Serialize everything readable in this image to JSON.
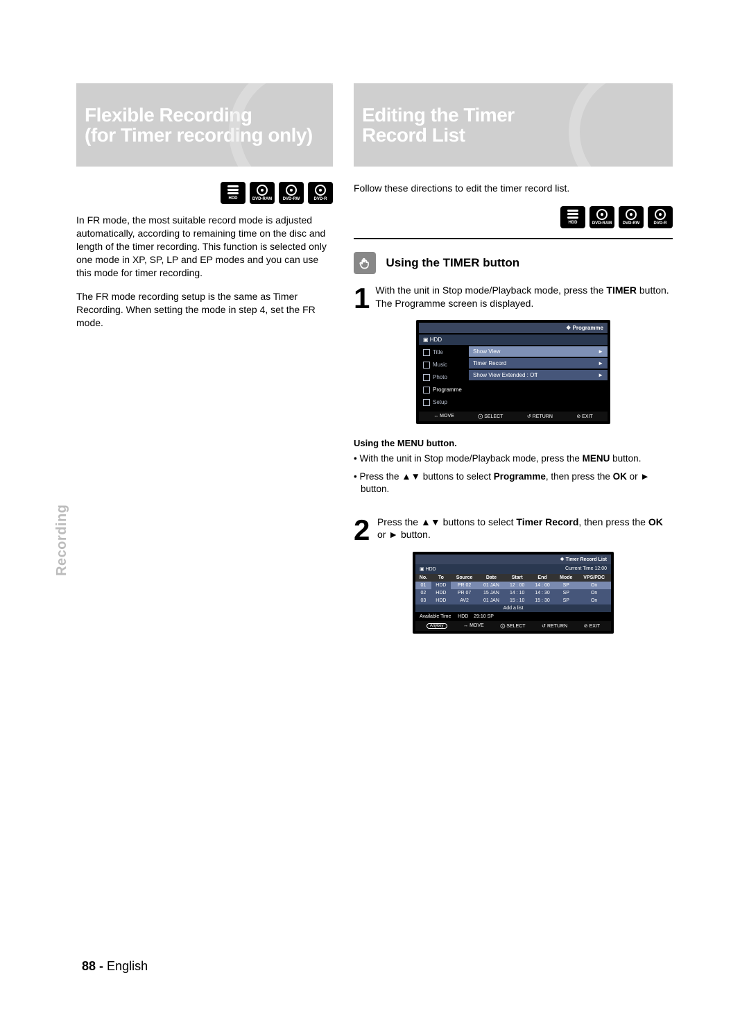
{
  "side_tab": "Recording",
  "page_number": "88 -",
  "page_lang": "English",
  "left": {
    "hero_line1": "Flexible Recording",
    "hero_line2": "(for Timer recording only)",
    "icons": [
      "HDD",
      "DVD-RAM",
      "DVD-RW",
      "DVD-R"
    ],
    "para1": "In FR mode, the most suitable record mode is adjusted automatically, according to remaining time on the disc and length of the timer recording. This function is selected only one mode in XP, SP, LP and EP modes and you can use this mode for timer recording.",
    "para2": "The FR mode recording setup is the same as Timer Recording. When setting the mode in step 4, set the FR mode."
  },
  "right": {
    "hero_line1": "Editing the Timer",
    "hero_line2": "Record List",
    "intro": "Follow these directions to edit the timer record list.",
    "icons": [
      "HDD",
      "DVD-RAM",
      "DVD-RW",
      "DVD-R"
    ],
    "sub_heading": "Using the TIMER button",
    "step1": {
      "num": "1",
      "pre": "With the unit in Stop mode/Playback mode, press the ",
      "bold1": "TIMER",
      "post": " button. The Programme screen is displayed."
    },
    "screen1": {
      "title_prefix": "❖ ",
      "title": "Programme",
      "hdd_label": "HDD",
      "menu_items": [
        "Title",
        "Music",
        "Photo",
        "Programme",
        "Setup"
      ],
      "panel_rows": [
        {
          "label": "Show View",
          "arrow": "►"
        },
        {
          "label": "Timer Record",
          "arrow": "►"
        },
        {
          "label": "Show View Extended  : Off",
          "arrow": "►"
        }
      ],
      "foot": [
        "↔ MOVE",
        "⨀ SELECT",
        "↺ RETURN",
        "⊘ EXIT"
      ]
    },
    "menu_heading": "Using the MENU button.",
    "menu_b1_pre": "• With the unit in Stop mode/Playback mode, press the ",
    "menu_b1_bold": "MENU",
    "menu_b1_post": " button.",
    "menu_b2_pre": "• Press the ▲▼ buttons to select ",
    "menu_b2_bold": "Programme",
    "menu_b2_post": ", then press the ",
    "menu_b2_bold2": "OK",
    "menu_b2_post2": " or ► button.",
    "step2": {
      "num": "2",
      "pre": "Press the ▲▼ buttons to select ",
      "bold1": "Timer Record",
      "mid": ", then press the ",
      "bold2": "OK",
      "post": " or ► button."
    },
    "screen2": {
      "title_prefix": "❖ ",
      "title": "Timer Record List",
      "hdd_label": "HDD",
      "current_time_label": "Current Time",
      "current_time": "12:00",
      "headers": [
        "No.",
        "To",
        "Source",
        "Date",
        "Start",
        "End",
        "Mode",
        "VPS/PDC"
      ],
      "rows": [
        {
          "no": "01",
          "to": "HDD",
          "src": "PR 02",
          "date": "01 JAN",
          "start": "12 : 00",
          "end": "14 : 00",
          "mode": "SP",
          "vps": "On"
        },
        {
          "no": "02",
          "to": "HDD",
          "src": "PR 07",
          "date": "15 JAN",
          "start": "14 : 10",
          "end": "14 : 30",
          "mode": "SP",
          "vps": "On"
        },
        {
          "no": "03",
          "to": "HDD",
          "src": "AV2",
          "date": "01 JAN",
          "start": "15 : 10",
          "end": "15 : 30",
          "mode": "SP",
          "vps": "On"
        }
      ],
      "add_label": "Add a list",
      "avail_label": "Available Time",
      "avail_dev": "HDD",
      "avail_val": "29:10 SP",
      "anykey": "Anykey",
      "foot": [
        "↔ MOVE",
        "⨀ SELECT",
        "↺ RETURN",
        "⊘ EXIT"
      ]
    }
  }
}
